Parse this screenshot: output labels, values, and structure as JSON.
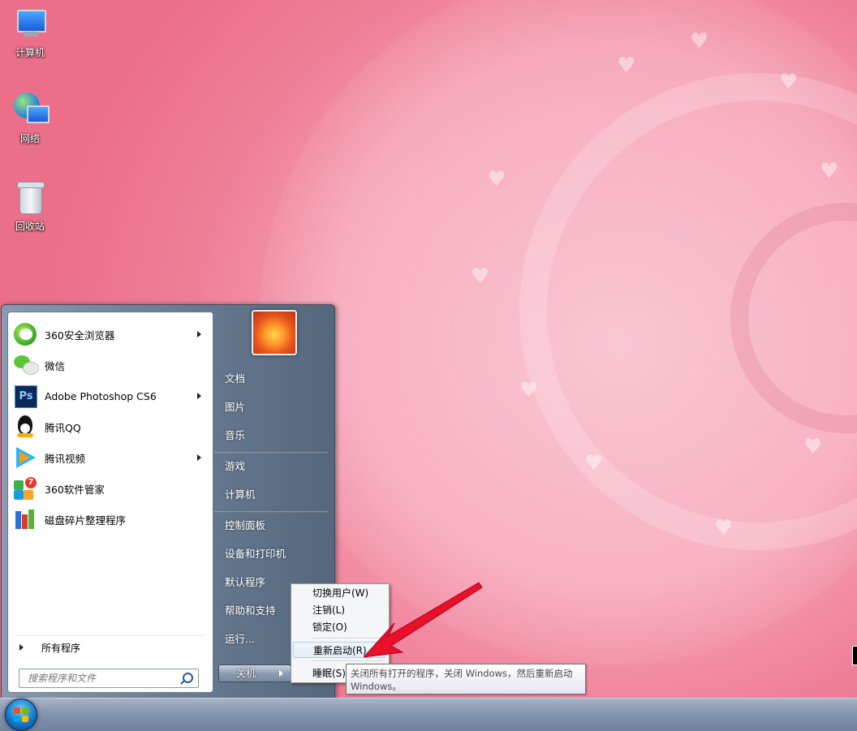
{
  "desktop": {
    "icons": [
      {
        "label": "计算机",
        "icon": "computer-icon"
      },
      {
        "label": "网络",
        "icon": "network-icon"
      },
      {
        "label": "回收站",
        "icon": "recycle-bin-icon"
      }
    ]
  },
  "start_menu": {
    "programs": [
      {
        "label": "360安全浏览器",
        "icon": "360-browser-icon",
        "has_submenu": true
      },
      {
        "label": "微信",
        "icon": "wechat-icon",
        "has_submenu": false
      },
      {
        "label": "Adobe Photoshop CS6",
        "icon": "photoshop-icon",
        "has_submenu": true
      },
      {
        "label": "腾讯QQ",
        "icon": "qq-icon",
        "has_submenu": false
      },
      {
        "label": "腾讯视频",
        "icon": "tencent-video-icon",
        "has_submenu": true
      },
      {
        "label": "360软件管家",
        "icon": "360-software-manager-icon",
        "has_submenu": false,
        "badge": "7"
      },
      {
        "label": "磁盘碎片整理程序",
        "icon": "disk-defragmenter-icon",
        "has_submenu": false
      }
    ],
    "all_programs": "所有程序",
    "search_placeholder": "搜索程序和文件",
    "right_items": [
      "文档",
      "图片",
      "音乐",
      "游戏",
      "计算机",
      "控制面板",
      "设备和打印机",
      "默认程序",
      "帮助和支持",
      "运行..."
    ],
    "shutdown_label": "关机"
  },
  "power_menu": {
    "items": [
      "切换用户(W)",
      "注销(L)",
      "锁定(O)",
      "重新启动(R)",
      "睡眠(S)"
    ],
    "highlighted": "重新启动(R)"
  },
  "tooltip": {
    "line1": "关闭所有打开的程序，关闭 Windows，然后重新启动",
    "line2": "Windows。"
  },
  "colors": {
    "accent": "#ef7f98",
    "arrow": "#e8102a",
    "taskbar": "#8293ad"
  }
}
